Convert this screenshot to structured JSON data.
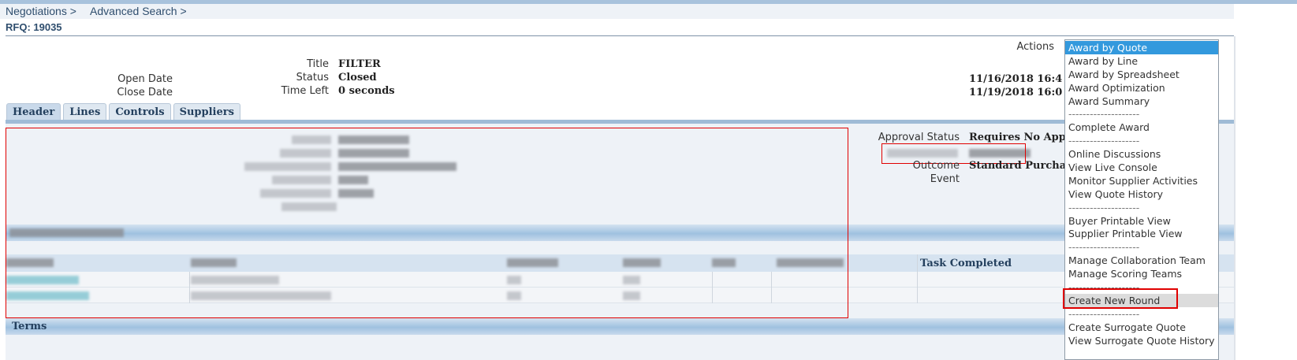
{
  "breadcrumbs": [
    "Negotiations >",
    "Advanced Search >"
  ],
  "page_title": "RFQ: 19035",
  "summary": {
    "title_label": "Title",
    "title_value": "FILTER",
    "status_label": "Status",
    "status_value": "Closed",
    "time_left_label": "Time Left",
    "time_left_value": "0 seconds",
    "open_date_label": "Open Date",
    "open_date_value": "11/16/2018 16:4",
    "close_date_label": "Close Date",
    "close_date_value": "11/19/2018 16:0"
  },
  "actions_label": "Actions",
  "actions_options": [
    "Award by Quote",
    "Award by Line",
    "Award by Spreadsheet",
    "Award Optimization",
    "Award Summary",
    "--------------------",
    "Complete Award",
    "--------------------",
    "Online Discussions",
    "View Live Console",
    "Monitor Supplier Activities",
    "View Quote History",
    "--------------------",
    "Buyer Printable View",
    "Supplier Printable View",
    "--------------------",
    "Manage Collaboration Team",
    "Manage Scoring Teams",
    "--------------------",
    "Create New Round",
    "--------------------",
    "Create Surrogate Quote",
    "View Surrogate Quote History"
  ],
  "actions_selected": "Award by Quote",
  "actions_highlighted": "Create New Round",
  "tabs": [
    "Header",
    "Lines",
    "Controls",
    "Suppliers"
  ],
  "header_details": {
    "approval_status_label": "Approval Status",
    "approval_status_value": "Requires No Appr",
    "outcome_label": "Outcome",
    "outcome_value": "Standard Purchas",
    "event_label": "Event"
  },
  "collab_table": {
    "task_completed_header": "Task Completed"
  },
  "terms_section": "Terms"
}
